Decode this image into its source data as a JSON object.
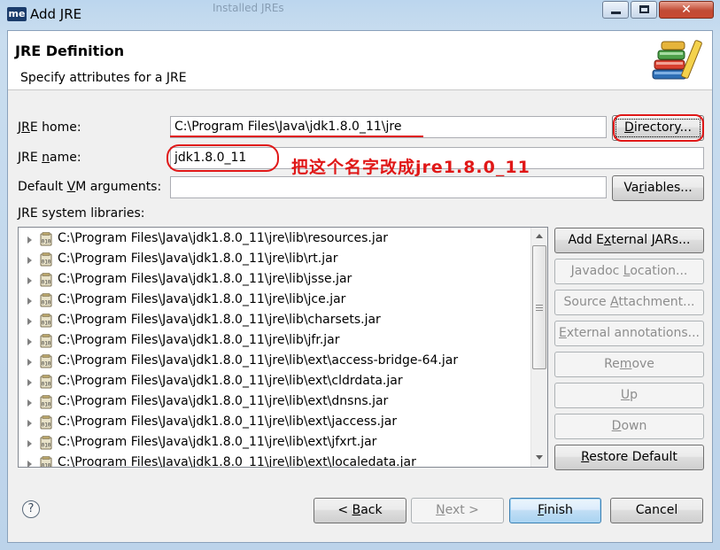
{
  "window": {
    "title": "Add JRE",
    "app_icon_text": "me",
    "background_ghost_text": "Installed JREs",
    "controls": {
      "minimize": "min",
      "maximize": "max",
      "close": "✕"
    }
  },
  "header": {
    "title": "JRE Definition",
    "description": "Specify attributes for a JRE"
  },
  "form": {
    "jre_home": {
      "label_pre": "J",
      "label_mn": "R",
      "label_post": "E home:",
      "value": "C:\\Program Files\\Java\\jdk1.8.0_11\\jre",
      "button": {
        "pre": "",
        "mn": "D",
        "post": "irectory..."
      }
    },
    "jre_name": {
      "label_pre": "JRE ",
      "label_mn": "n",
      "label_post": "ame:",
      "value": "jdk1.8.0_11"
    },
    "vm_args": {
      "label_pre": "Default ",
      "label_mn": "V",
      "label_post": "M arguments:",
      "value": "",
      "button": {
        "pre": "Va",
        "mn": "r",
        "post": "iables..."
      }
    },
    "libraries_label": "JRE system libraries:"
  },
  "annotation": {
    "note": "把这个名字改成jre1.8.0_11"
  },
  "libraries": [
    "C:\\Program Files\\Java\\jdk1.8.0_11\\jre\\lib\\resources.jar",
    "C:\\Program Files\\Java\\jdk1.8.0_11\\jre\\lib\\rt.jar",
    "C:\\Program Files\\Java\\jdk1.8.0_11\\jre\\lib\\jsse.jar",
    "C:\\Program Files\\Java\\jdk1.8.0_11\\jre\\lib\\jce.jar",
    "C:\\Program Files\\Java\\jdk1.8.0_11\\jre\\lib\\charsets.jar",
    "C:\\Program Files\\Java\\jdk1.8.0_11\\jre\\lib\\jfr.jar",
    "C:\\Program Files\\Java\\jdk1.8.0_11\\jre\\lib\\ext\\access-bridge-64.jar",
    "C:\\Program Files\\Java\\jdk1.8.0_11\\jre\\lib\\ext\\cldrdata.jar",
    "C:\\Program Files\\Java\\jdk1.8.0_11\\jre\\lib\\ext\\dnsns.jar",
    "C:\\Program Files\\Java\\jdk1.8.0_11\\jre\\lib\\ext\\jaccess.jar",
    "C:\\Program Files\\Java\\jdk1.8.0_11\\jre\\lib\\ext\\jfxrt.jar",
    "C:\\Program Files\\Java\\jdk1.8.0_11\\jre\\lib\\ext\\localedata.jar"
  ],
  "side_buttons": {
    "add_external": {
      "pre": "Add E",
      "mn": "x",
      "post": "ternal JARs...",
      "enabled": true
    },
    "javadoc": {
      "pre": "Javadoc ",
      "mn": "L",
      "post": "ocation...",
      "enabled": false
    },
    "source": {
      "pre": "Source ",
      "mn": "A",
      "post": "ttachment...",
      "enabled": false
    },
    "external_annotations": {
      "pre": "",
      "mn": "E",
      "post": "xternal annotations...",
      "enabled": false
    },
    "remove": {
      "pre": "Re",
      "mn": "m",
      "post": "ove",
      "enabled": false
    },
    "up": {
      "pre": "",
      "mn": "U",
      "post": "p",
      "enabled": false
    },
    "down": {
      "pre": "",
      "mn": "D",
      "post": "own",
      "enabled": false
    },
    "restore": {
      "pre": "",
      "mn": "R",
      "post": "estore Default",
      "enabled": true
    }
  },
  "footer": {
    "help": "?",
    "back": {
      "pre": "< ",
      "mn": "B",
      "post": "ack"
    },
    "next": {
      "pre": "",
      "mn": "N",
      "post": "ext >"
    },
    "finish": {
      "pre": "",
      "mn": "F",
      "post": "inish"
    },
    "cancel": "Cancel"
  },
  "colors": {
    "annotation_red": "#e01818",
    "default_button_border": "#3c7fb1",
    "disabled_text": "#8d8d8d"
  }
}
